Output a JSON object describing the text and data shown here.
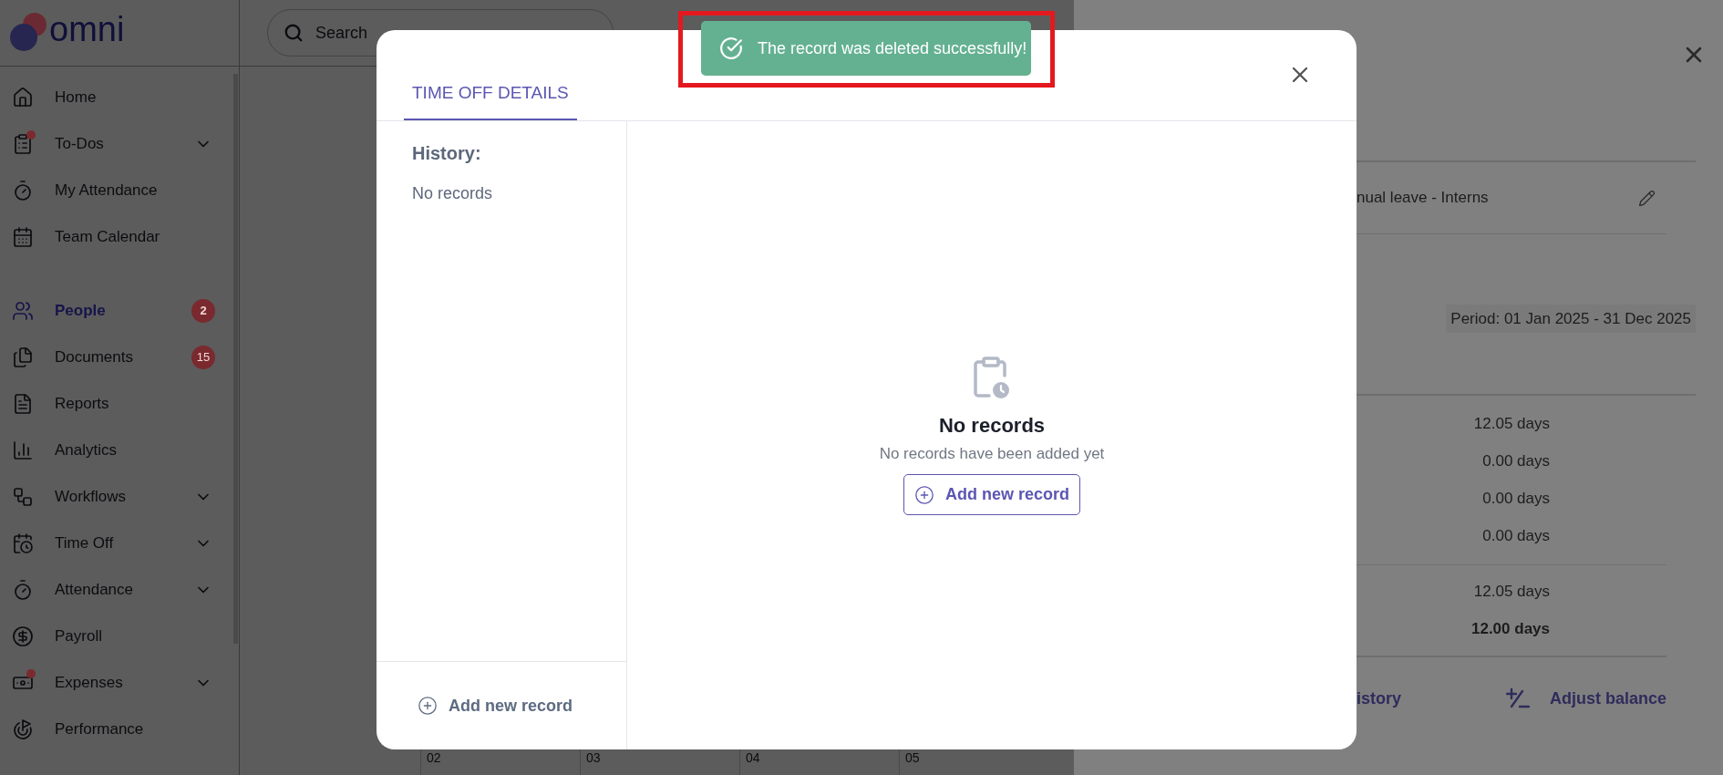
{
  "logo": {
    "text": "omni"
  },
  "search": {
    "placeholder": "Search"
  },
  "sidebar": {
    "sections": [
      [
        {
          "label": "Home",
          "selected": false,
          "expandable": false,
          "notification": false
        },
        {
          "label": "To-Dos",
          "selected": false,
          "expandable": true,
          "notification": true
        },
        {
          "label": "My Attendance",
          "selected": false,
          "expandable": false,
          "notification": false
        },
        {
          "label": "Team Calendar",
          "selected": false,
          "expandable": false,
          "notification": false
        }
      ],
      [
        {
          "label": "People",
          "selected": true,
          "expandable": false,
          "notification": false,
          "badge": "2"
        },
        {
          "label": "Documents",
          "selected": false,
          "expandable": false,
          "notification": false,
          "badge": "15"
        },
        {
          "label": "Reports",
          "selected": false,
          "expandable": false,
          "notification": false
        },
        {
          "label": "Analytics",
          "selected": false,
          "expandable": false,
          "notification": false
        },
        {
          "label": "Workflows",
          "selected": false,
          "expandable": true,
          "notification": false
        },
        {
          "label": "Time Off",
          "selected": false,
          "expandable": true,
          "notification": false
        },
        {
          "label": "Attendance",
          "selected": false,
          "expandable": true,
          "notification": false
        },
        {
          "label": "Payroll",
          "selected": false,
          "expandable": false,
          "notification": false
        },
        {
          "label": "Expenses",
          "selected": false,
          "expandable": true,
          "notification": true
        },
        {
          "label": "Performance",
          "selected": false,
          "expandable": false,
          "notification": false
        }
      ]
    ]
  },
  "calendar": {
    "days": [
      "02",
      "03",
      "04",
      "05"
    ]
  },
  "drawer": {
    "policy": "nual leave - Interns",
    "period": "Period: 01 Jan 2025 - 31 Dec 2025",
    "rows": [
      {
        "value": "12.05 days",
        "bold": false
      },
      {
        "value": "0.00 days",
        "bold": false
      },
      {
        "value": "0.00 days",
        "bold": false
      },
      {
        "value": "0.00 days",
        "bold": false
      }
    ],
    "totals": [
      {
        "value": "12.05 days",
        "bold": false
      },
      {
        "value": "12.00 days",
        "bold": true
      }
    ],
    "actions": [
      {
        "label": "istory",
        "kind": "link"
      },
      {
        "label": "Adjust balance",
        "kind": "adjust"
      }
    ]
  },
  "modal": {
    "tabs": [
      {
        "label": "TIME OFF DETAILS",
        "selected": true
      }
    ],
    "history_label": "History:",
    "history_empty": "No records",
    "add_button": "Add new record",
    "empty_state": {
      "title": "No records",
      "subtitle": "No records have been added yet",
      "button": "Add new record"
    }
  },
  "toast": {
    "text": "The record was deleted successfully!",
    "highlighted": true
  }
}
